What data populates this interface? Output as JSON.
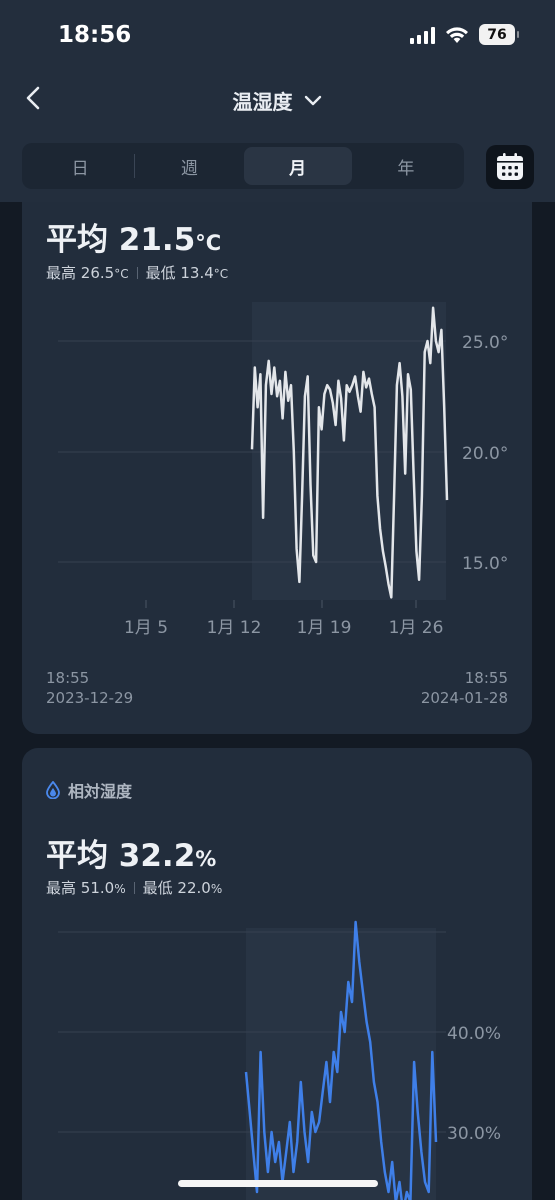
{
  "status_bar": {
    "time": "18:56",
    "battery": "76"
  },
  "nav": {
    "title": "温湿度"
  },
  "period_tabs": [
    {
      "label": "日",
      "active": false
    },
    {
      "label": "週",
      "active": false
    },
    {
      "label": "月",
      "active": true
    },
    {
      "label": "年",
      "active": false
    }
  ],
  "temperature": {
    "avg_label": "平均",
    "avg_value": "21.5",
    "unit": "°C",
    "max_label": "最高",
    "max_value": "26.5",
    "min_label": "最低",
    "min_value": "13.4",
    "line_color": "#e3e6ea",
    "y_ticks": [
      "25.0°",
      "20.0°",
      "15.0°"
    ],
    "x_ticks": [
      "1月 5",
      "1月 12",
      "1月 19",
      "1月 26"
    ],
    "start_time": "18:55",
    "start_date": "2023-12-29",
    "end_time": "18:55",
    "end_date": "2024-01-28"
  },
  "humidity": {
    "section_label": "相対湿度",
    "avg_label": "平均",
    "avg_value": "32.2",
    "unit": "%",
    "max_label": "最高",
    "max_value": "51.0",
    "min_label": "最低",
    "min_value": "22.0",
    "line_color": "#3f7fe8",
    "y_ticks": [
      "40.0%",
      "30.0%"
    ]
  },
  "chart_data": [
    {
      "type": "line",
      "series": [
        {
          "values": [
            20.1,
            23.8,
            22.0,
            23.5,
            17.0,
            23.0,
            24.1,
            22.6,
            23.8,
            22.5,
            23.2,
            21.5,
            23.6,
            22.3,
            23.0,
            20.0,
            15.6,
            14.1,
            18.0,
            22.5,
            23.4,
            18.5,
            15.3,
            15.0,
            22.0,
            21.0,
            22.6,
            23.0,
            22.8,
            22.2,
            21.2,
            23.2,
            22.4,
            20.5,
            23.0,
            22.7,
            23.0,
            23.4,
            22.5,
            21.8,
            23.6,
            22.9,
            23.3,
            22.6,
            22.0,
            18.0,
            16.5,
            15.5,
            14.8,
            14.0,
            13.4,
            18.0,
            23.0,
            24.0,
            22.5,
            19.0,
            23.5,
            22.8,
            19.0,
            15.5,
            14.2,
            18.0,
            24.5,
            25.0,
            24.0,
            26.5,
            25.0,
            24.5,
            25.5,
            22.0,
            17.8
          ]
        }
      ],
      "y_ticks": [
        25.0,
        20.0,
        15.0
      ],
      "x_tick_labels": [
        "1月 5",
        "1月 12",
        "1月 19",
        "1月 26"
      ]
    },
    {
      "type": "line",
      "series": [
        {
          "values": [
            36.0,
            32.0,
            28.0,
            24.0,
            38.0,
            30.0,
            26.0,
            30.0,
            27.0,
            29.0,
            25.0,
            28.0,
            31.0,
            26.0,
            29.0,
            35.0,
            30.0,
            27.0,
            32.0,
            30.0,
            31.0,
            34.0,
            37.0,
            33.0,
            38.0,
            36.0,
            42.0,
            40.0,
            45.0,
            43.0,
            51.0,
            47.0,
            44.0,
            41.0,
            39.0,
            35.0,
            33.0,
            29.0,
            26.0,
            24.0,
            27.0,
            23.0,
            25.0,
            22.0,
            24.0,
            23.0,
            37.0,
            32.0,
            28.0,
            25.0,
            24.0,
            38.0,
            29.0
          ]
        }
      ],
      "y_ticks": [
        40.0,
        30.0
      ]
    }
  ]
}
